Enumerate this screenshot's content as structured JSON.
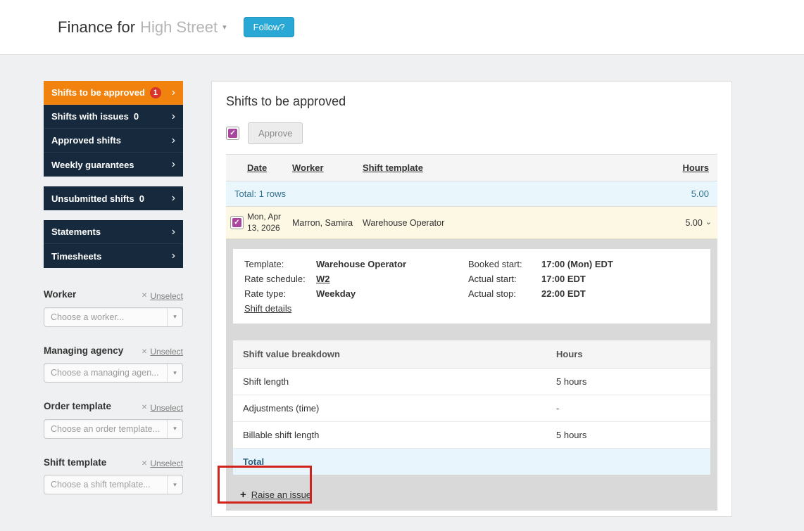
{
  "icons": {
    "chevron_right": "›",
    "caret_down": "▾",
    "expand_caret": "⌄",
    "x": "✕",
    "plus": "+",
    "check": "✓"
  },
  "colors": {
    "accent_orange": "#f0820d",
    "navy": "#16293d",
    "badge_red": "#d9342b",
    "follow_cyan": "#29a8d6",
    "checkbox_purple": "#a9459f",
    "total_row_bg": "#e9f7fc",
    "total_row_text": "#31708f",
    "selected_row_bg": "#fdf8e3",
    "panel_gray": "#d9d9d9",
    "annotation_red": "#cf231c"
  },
  "header": {
    "title_prefix": "Finance for",
    "title_account": "High Street",
    "follow_button": "Follow?"
  },
  "sidebar": {
    "nav_primary": [
      {
        "label": "Shifts to be approved",
        "count": "1"
      },
      {
        "label": "Shifts with issues",
        "count": "0"
      },
      {
        "label": "Approved shifts"
      },
      {
        "label": "Weekly guarantees"
      }
    ],
    "nav_unsubmitted": {
      "label": "Unsubmitted shifts",
      "count": "0"
    },
    "nav_reports": [
      {
        "label": "Statements"
      },
      {
        "label": "Timesheets"
      }
    ],
    "filters": [
      {
        "label": "Worker",
        "unselect": "Unselect",
        "placeholder": "Choose a worker..."
      },
      {
        "label": "Managing agency",
        "unselect": "Unselect",
        "placeholder": "Choose a managing agen..."
      },
      {
        "label": "Order template",
        "unselect": "Unselect",
        "placeholder": "Choose an order template..."
      },
      {
        "label": "Shift template",
        "unselect": "Unselect",
        "placeholder": "Choose a shift template..."
      }
    ]
  },
  "main": {
    "title": "Shifts to be approved",
    "approve_button": "Approve",
    "table": {
      "col_date": "Date",
      "col_worker": "Worker",
      "col_template": "Shift template",
      "col_hours": "Hours",
      "total_label": "Total: 1 rows",
      "total_hours": "5.00",
      "row": {
        "date": "Mon, Apr 13, 2026",
        "worker": "Marron, Samira",
        "shift_template": "Warehouse Operator",
        "hours": "5.00"
      }
    },
    "detail": {
      "template_label": "Template:",
      "template_value": "Warehouse Operator",
      "rate_schedule_label": "Rate schedule:",
      "rate_schedule_value": "W2",
      "rate_type_label": "Rate type:",
      "rate_type_value": "Weekday",
      "shift_details_link": "Shift details",
      "booked_start_label": "Booked start:",
      "booked_start_value": "17:00 (Mon) EDT",
      "actual_start_label": "Actual start:",
      "actual_start_value": "17:00 EDT",
      "actual_stop_label": "Actual stop:",
      "actual_stop_value": "22:00 EDT",
      "breakdown": {
        "title": "Shift value breakdown",
        "hours_header": "Hours",
        "rows": [
          {
            "label": "Shift length",
            "value": "5 hours"
          },
          {
            "label": "Adjustments (time)",
            "value": "-"
          },
          {
            "label": "Billable shift length",
            "value": "5 hours"
          }
        ],
        "total_label": "Total"
      },
      "raise_issue": "Raise an issue"
    }
  }
}
